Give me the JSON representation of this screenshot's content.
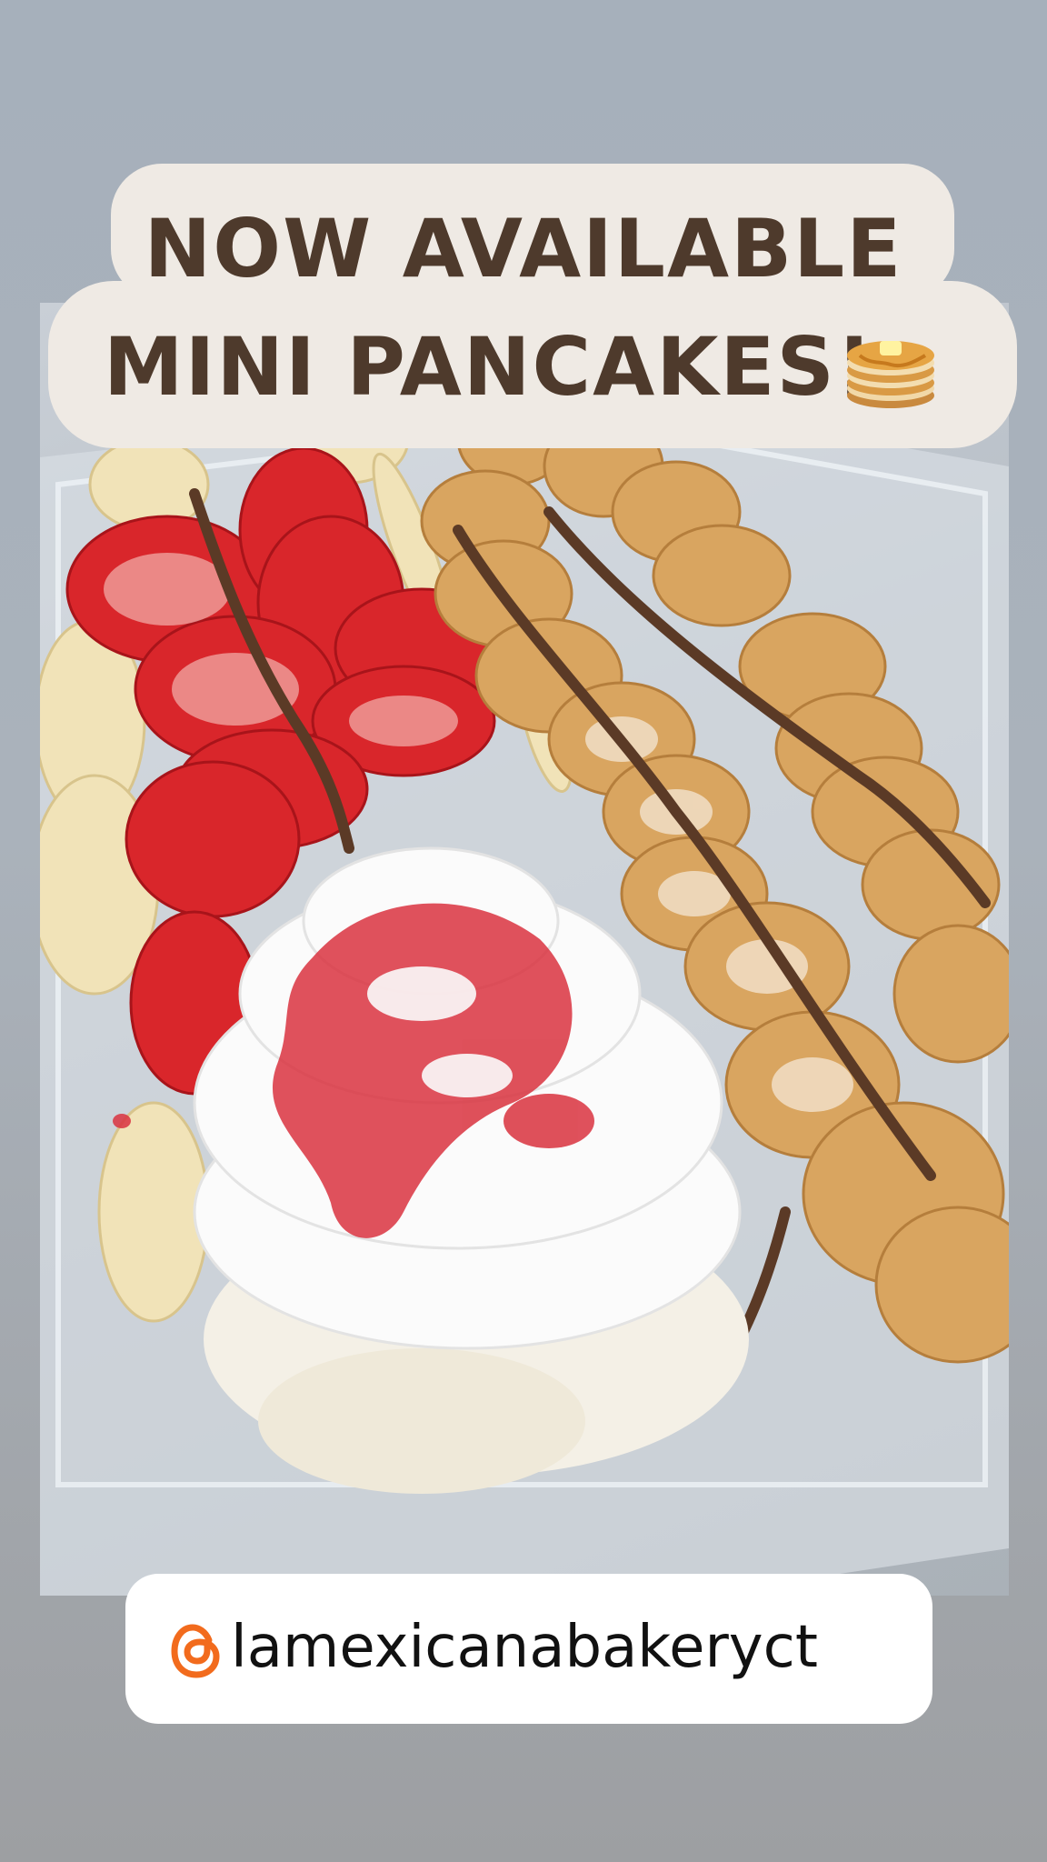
{
  "story": {
    "title": {
      "line1": "NOW AVAILABLE",
      "line2": "MINI PANCAKES!",
      "emoji_name": "pancakes-emoji"
    },
    "handle": {
      "text": "lamexicanabakeryct",
      "icon_name": "threads-icon"
    },
    "photo": {
      "subject": "photo-mini-pancakes-dessert"
    }
  },
  "colors": {
    "title_text": "#4e3a2c",
    "title_bubble": "#efeae4",
    "handle_pill": "#ffffff",
    "threads_icon": "#f26b1d"
  }
}
